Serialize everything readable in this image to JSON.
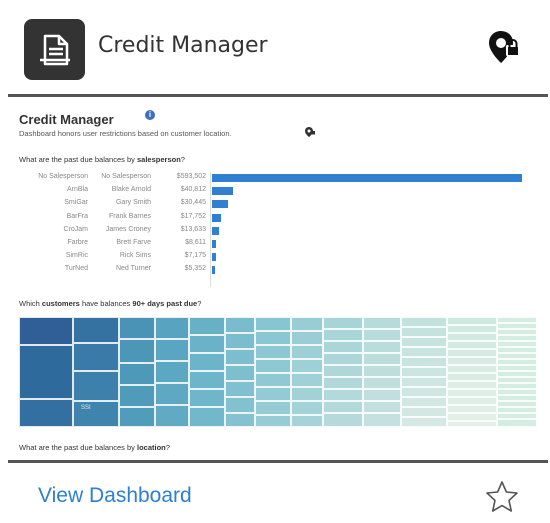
{
  "header": {
    "title": "Credit Manager",
    "app_icon": "document-icon",
    "status_icon": "location-lock-icon"
  },
  "preview": {
    "title": "Credit Manager",
    "info_icon": "info-icon",
    "subtitle": "Dashboard honors user restrictions based on customer location.",
    "subtitle_icon": "location-lock-icon",
    "q1_prefix": "What are the past due balances by ",
    "q1_bold": "salesperson",
    "q1_suffix": "?",
    "q2_prefix": "Which ",
    "q2_bold1": "customers",
    "q2_mid": " have balances ",
    "q2_bold2": "90+ days past due",
    "q2_suffix": "?",
    "q3_prefix": "What are the past due balances by ",
    "q3_bold": "location",
    "q3_suffix": "?",
    "treemap_label": "SSI",
    "salespeople": [
      {
        "id": "No Salesperson",
        "name": "No Salesperson",
        "balance": "$593,502",
        "value": 593502
      },
      {
        "id": "ArnBla",
        "name": "Blake Arnold",
        "balance": "$40,812",
        "value": 40812
      },
      {
        "id": "SmiGar",
        "name": "Gary Smith",
        "balance": "$30,445",
        "value": 30445
      },
      {
        "id": "BarFra",
        "name": "Frank Barnes",
        "balance": "$17,752",
        "value": 17752
      },
      {
        "id": "CroJam",
        "name": "James Croney",
        "balance": "$13,633",
        "value": 13633
      },
      {
        "id": "Farbre",
        "name": "Brett Farve",
        "balance": "$8,611",
        "value": 8611
      },
      {
        "id": "SimRic",
        "name": "Rick Sims",
        "balance": "$7,175",
        "value": 7175
      },
      {
        "id": "TurNed",
        "name": "Ned Turner",
        "balance": "$5,352",
        "value": 5352
      }
    ],
    "bar_color": "#2f80d1"
  },
  "footer": {
    "view_label": "View Dashboard",
    "favorite_icon": "star-icon",
    "link_color": "#2e7fd1"
  }
}
